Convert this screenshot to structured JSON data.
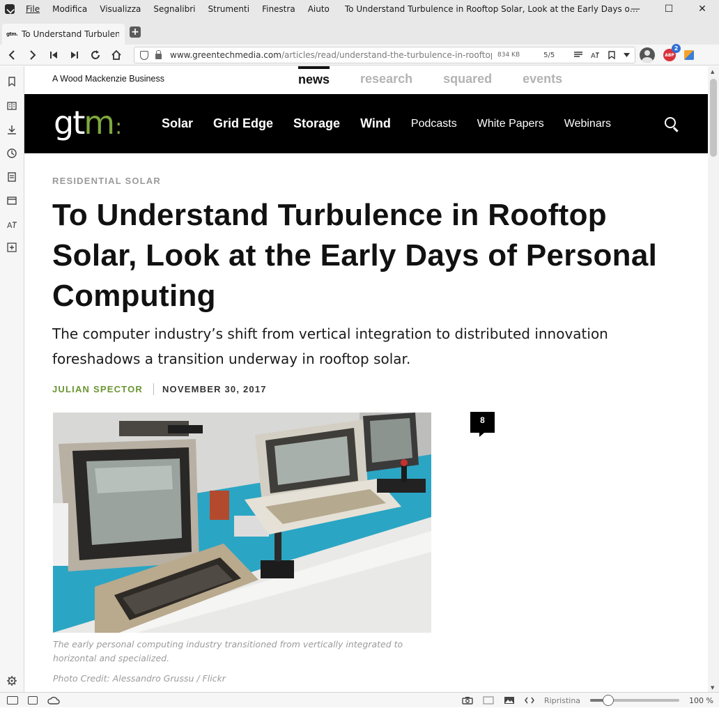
{
  "window": {
    "menu": [
      "File",
      "Modifica",
      "Visualizza",
      "Segnalibri",
      "Strumenti",
      "Finestra",
      "Aiuto"
    ],
    "title": "To Understand Turbulence in Rooftop Solar, Look at the Early Days of Personal...",
    "controls": {
      "minimize": "—",
      "maximize": "☐",
      "close": "✕"
    }
  },
  "tab": {
    "favicon_text": "gtm.",
    "label": "To Understand Turbulence",
    "new_tab": "+"
  },
  "address": {
    "url_host": "www.greentechmedia.com",
    "url_path": "/articles/read/understand-the-turbulence-in-rooftop...",
    "page_size": "834 KB",
    "pages": "5/5",
    "extension_badge": "2",
    "extension_label": "ABP"
  },
  "statusbar": {
    "zoom_reset": "Ripristina",
    "zoom_level": "100 %",
    "zoom_fraction": 0.2
  },
  "site": {
    "parent": "A Wood Mackenzie Business",
    "sections": [
      {
        "label": "news",
        "active": true
      },
      {
        "label": "research",
        "active": false
      },
      {
        "label": "squared",
        "active": false
      },
      {
        "label": "events",
        "active": false
      }
    ],
    "logo_main": "gt",
    "logo_m": "m",
    "logo_dots": ":",
    "nav_primary": [
      "Solar",
      "Grid Edge",
      "Storage",
      "Wind"
    ],
    "nav_secondary": [
      "Podcasts",
      "White Papers",
      "Webinars"
    ]
  },
  "article": {
    "category": "RESIDENTIAL SOLAR",
    "headline": "To Understand Turbulence in Rooftop Solar, Look at the Early Days of Personal Computing",
    "dek": "The computer industry’s shift from vertical integration to distributed innovation foreshadows a transition underway in rooftop solar.",
    "author": "JULIAN SPECTOR",
    "date": "NOVEMBER 30, 2017",
    "comment_count": "8",
    "caption": "The early personal computing industry transitioned from vertically integrated to horizontal and specialized.",
    "credit": "Photo Credit: Alessandro Grussu / Flickr"
  },
  "colors": {
    "brand_green": "#7ea83e",
    "author_green": "#6a9632",
    "nav_bg": "#000000",
    "table_teal": "#2ba5c4"
  }
}
